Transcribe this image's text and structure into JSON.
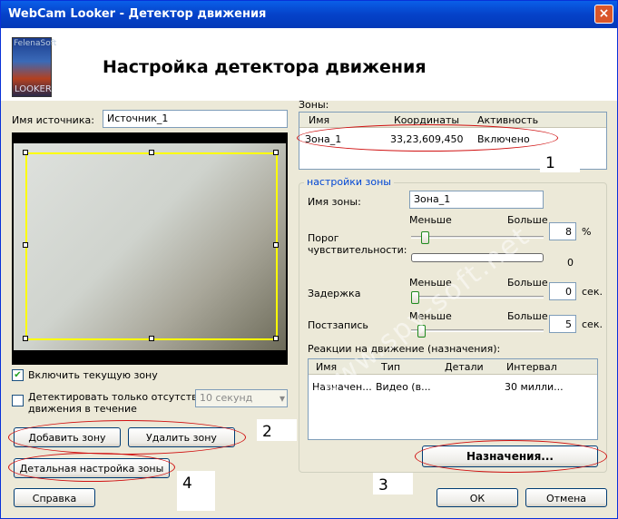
{
  "window": {
    "title": "WebCam Looker - Детектор движения",
    "close": "×"
  },
  "header": {
    "logo_top": "FelenaSoft",
    "logo_bottom": "LOOKER",
    "title": "Настройка детектора движения"
  },
  "source": {
    "label": "Имя источника:",
    "value": "Источник_1"
  },
  "zones": {
    "label": "Зоны:",
    "columns": [
      "Имя",
      "Координаты",
      "Активность"
    ],
    "rows": [
      {
        "name": "Зона_1",
        "coords": "33,23,609,450",
        "active": "Включено"
      }
    ]
  },
  "zone_settings": {
    "title": "настройки зоны",
    "name_label": "Имя зоны:",
    "name_value": "Зона_1",
    "less": "Меньше",
    "more": "Больше",
    "threshold_label_1": "Порог",
    "threshold_label_2": "чувствительности:",
    "threshold_value": "8",
    "threshold_unit": "%",
    "threshold_level": 0.08,
    "progress_value": "0",
    "delay_label": "Задержка",
    "delay_value": "0",
    "delay_unit": "сек.",
    "delay_level": 0,
    "post_label": "Постзапись",
    "post_value": "5",
    "post_unit": "сек.",
    "post_level": 0.05,
    "reactions_label": "Реакции на движение (назначения):",
    "reactions_columns": [
      "Имя",
      "Тип",
      "Детали",
      "Интервал"
    ],
    "reactions_rows": [
      {
        "name": "Назначен...",
        "type": "Видео (в...",
        "details": "",
        "interval": "30 милли..."
      }
    ],
    "assign_button": "Назначения..."
  },
  "options": {
    "enable_zone": "Включить текущую зону",
    "enable_checked": "✔",
    "detect_absence_1": "Детектировать только отсутствие",
    "detect_absence_2": "движения в течение",
    "duration": "10 секунд",
    "duration_arrow": "▾"
  },
  "buttons": {
    "add_zone": "Добавить зону",
    "delete_zone": "Удалить зону",
    "detail": "Детальная настройка зоны",
    "help": "Справка",
    "ok": "ОК",
    "cancel": "Отмена"
  },
  "annotations": {
    "n1": "1",
    "n2": "2",
    "n3": "3",
    "n4": "4"
  },
  "watermark": "www.spy-soft.net"
}
